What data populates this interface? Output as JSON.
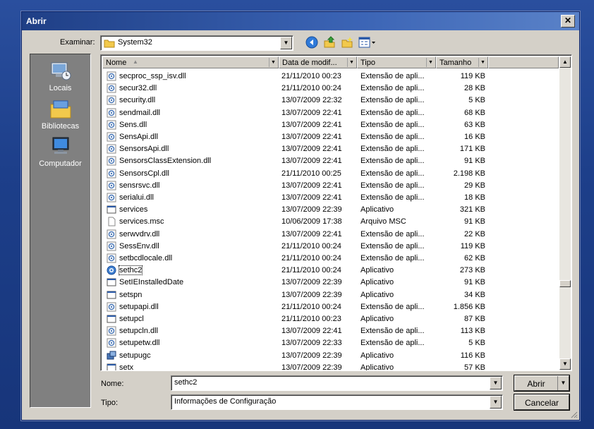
{
  "dialog": {
    "title": "Abrir",
    "close_label": "✕"
  },
  "lookin": {
    "label": "Examinar:",
    "value": "System32"
  },
  "places": [
    {
      "label": "Locais",
      "icon": "recent-places-icon"
    },
    {
      "label": "Bibliotecas",
      "icon": "libraries-icon"
    },
    {
      "label": "Computador",
      "icon": "computer-icon"
    }
  ],
  "columns": {
    "name": "Nome",
    "date": "Data de modif...",
    "type": "Tipo",
    "size": "Tamanho"
  },
  "files": [
    {
      "name": "secproc_ssp_isv.dll",
      "date": "21/11/2010 00:23",
      "type": "Extensão de apli...",
      "size": "119 KB",
      "icon": "dll"
    },
    {
      "name": "secur32.dll",
      "date": "21/11/2010 00:24",
      "type": "Extensão de apli...",
      "size": "28 KB",
      "icon": "dll"
    },
    {
      "name": "security.dll",
      "date": "13/07/2009 22:32",
      "type": "Extensão de apli...",
      "size": "5 KB",
      "icon": "dll"
    },
    {
      "name": "sendmail.dll",
      "date": "13/07/2009 22:41",
      "type": "Extensão de apli...",
      "size": "68 KB",
      "icon": "dll"
    },
    {
      "name": "Sens.dll",
      "date": "13/07/2009 22:41",
      "type": "Extensão de apli...",
      "size": "63 KB",
      "icon": "dll"
    },
    {
      "name": "SensApi.dll",
      "date": "13/07/2009 22:41",
      "type": "Extensão de apli...",
      "size": "16 KB",
      "icon": "dll"
    },
    {
      "name": "SensorsApi.dll",
      "date": "13/07/2009 22:41",
      "type": "Extensão de apli...",
      "size": "171 KB",
      "icon": "dll"
    },
    {
      "name": "SensorsClassExtension.dll",
      "date": "13/07/2009 22:41",
      "type": "Extensão de apli...",
      "size": "91 KB",
      "icon": "dll"
    },
    {
      "name": "SensorsCpl.dll",
      "date": "21/11/2010 00:25",
      "type": "Extensão de apli...",
      "size": "2.198 KB",
      "icon": "dll"
    },
    {
      "name": "sensrsvc.dll",
      "date": "13/07/2009 22:41",
      "type": "Extensão de apli...",
      "size": "29 KB",
      "icon": "dll"
    },
    {
      "name": "serialui.dll",
      "date": "13/07/2009 22:41",
      "type": "Extensão de apli...",
      "size": "18 KB",
      "icon": "dll"
    },
    {
      "name": "services",
      "date": "13/07/2009 22:39",
      "type": "Aplicativo",
      "size": "321 KB",
      "icon": "exe"
    },
    {
      "name": "services.msc",
      "date": "10/06/2009 17:38",
      "type": "Arquivo MSC",
      "size": "91 KB",
      "icon": "doc"
    },
    {
      "name": "serwvdrv.dll",
      "date": "13/07/2009 22:41",
      "type": "Extensão de apli...",
      "size": "22 KB",
      "icon": "dll"
    },
    {
      "name": "SessEnv.dll",
      "date": "21/11/2010 00:24",
      "type": "Extensão de apli...",
      "size": "119 KB",
      "icon": "dll"
    },
    {
      "name": "setbcdlocale.dll",
      "date": "21/11/2010 00:24",
      "type": "Extensão de apli...",
      "size": "62 KB",
      "icon": "dll"
    },
    {
      "name": "sethc2",
      "date": "21/11/2010 00:24",
      "type": "Aplicativo",
      "size": "273 KB",
      "icon": "sethc",
      "selected": true
    },
    {
      "name": "SetIEInstalledDate",
      "date": "13/07/2009 22:39",
      "type": "Aplicativo",
      "size": "91 KB",
      "icon": "exe"
    },
    {
      "name": "setspn",
      "date": "13/07/2009 22:39",
      "type": "Aplicativo",
      "size": "34 KB",
      "icon": "exe"
    },
    {
      "name": "setupapi.dll",
      "date": "21/11/2010 00:24",
      "type": "Extensão de apli...",
      "size": "1.856 KB",
      "icon": "dll"
    },
    {
      "name": "setupcl",
      "date": "21/11/2010 00:23",
      "type": "Aplicativo",
      "size": "87 KB",
      "icon": "exe"
    },
    {
      "name": "setupcln.dll",
      "date": "13/07/2009 22:41",
      "type": "Extensão de apli...",
      "size": "113 KB",
      "icon": "dll"
    },
    {
      "name": "setupetw.dll",
      "date": "13/07/2009 22:33",
      "type": "Extensão de apli...",
      "size": "5 KB",
      "icon": "dll"
    },
    {
      "name": "setupugc",
      "date": "13/07/2009 22:39",
      "type": "Aplicativo",
      "size": "116 KB",
      "icon": "setup"
    },
    {
      "name": "setx",
      "date": "13/07/2009 22:39",
      "type": "Aplicativo",
      "size": "57 KB",
      "icon": "exe"
    }
  ],
  "filename": {
    "label": "Nome:",
    "value": "sethc2"
  },
  "filetype": {
    "label": "Tipo:",
    "value": "Informações de Configuração"
  },
  "buttons": {
    "open": "Abrir",
    "cancel": "Cancelar"
  }
}
